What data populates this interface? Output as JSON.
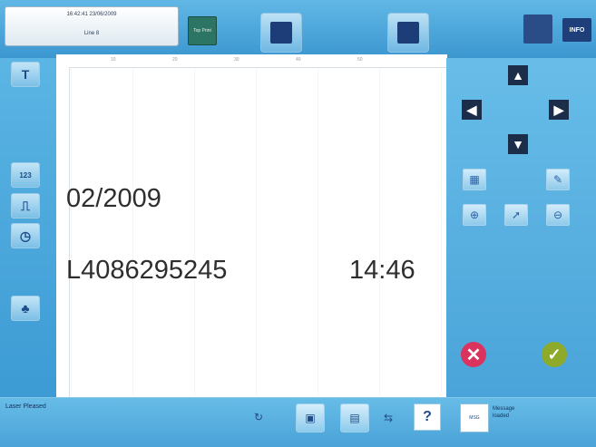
{
  "header": {
    "datetime": "16:42:41  23/06/2009",
    "line_label": "Line 8",
    "small_btn_label": "Top Print",
    "info_label": "INFO"
  },
  "left_tools": [
    {
      "name": "text-tool",
      "glyph": "T"
    },
    {
      "name": "counter-tool",
      "glyph": "123"
    },
    {
      "name": "barcode-tool",
      "glyph": "⎍"
    },
    {
      "name": "clock-tool",
      "glyph": "◷"
    },
    {
      "name": "logo-tool",
      "glyph": "♣"
    }
  ],
  "canvas": {
    "date_text": "02/2009",
    "code_text": "L4086295245",
    "time_text": "14:46"
  },
  "ruler_ticks": [
    "0",
    "10",
    "20",
    "30",
    "40",
    "50"
  ],
  "right_panel": {
    "arrows": {
      "up": "▲",
      "down": "▼",
      "left": "◀",
      "right": "▶"
    },
    "tools": [
      {
        "name": "grid",
        "glyph": "▦"
      },
      {
        "name": "edit",
        "glyph": "✎"
      },
      {
        "name": "zoom-in",
        "glyph": "⊕"
      },
      {
        "name": "select",
        "glyph": "➚"
      },
      {
        "name": "zoom-out",
        "glyph": "⊖"
      }
    ],
    "cancel_glyph": "✕",
    "ok_glyph": "✓"
  },
  "footer": {
    "status_text": "Laser Pleased",
    "help_glyph": "?",
    "message_icon_label": "MSG",
    "message_text_line1": "Message",
    "message_text_line2": "loaded"
  },
  "colors": {
    "panel": "#5cb3e0",
    "cancel": "#d9335e",
    "ok": "#8eaa2b",
    "text": "#2e2e2e"
  }
}
